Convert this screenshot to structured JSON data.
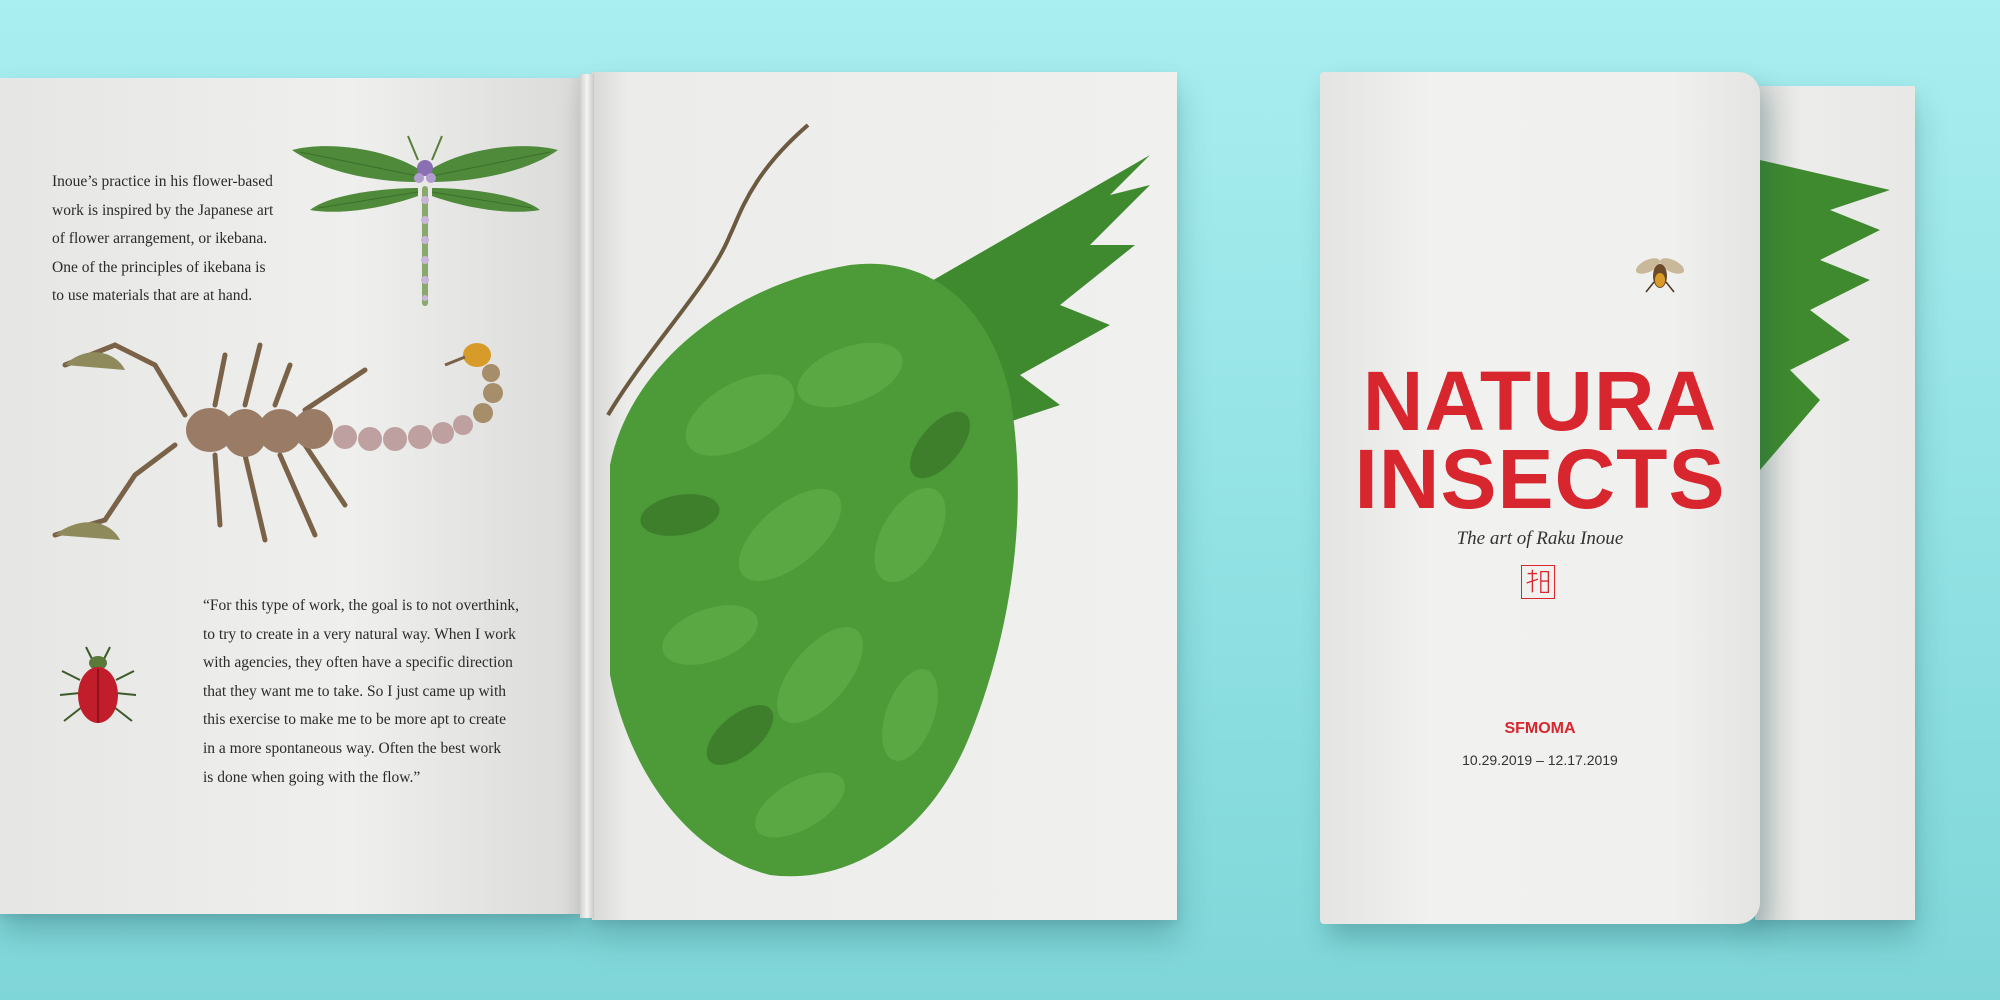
{
  "left_page": {
    "intro_lines": [
      "Inoue’s practice in his flower-based",
      "work is inspired by the Japanese art",
      "of flower arrangement, or ikebana.",
      "One of the principles of ikebana is",
      "to use materials that are at hand."
    ],
    "quote_lines": [
      "“For this type of work, the goal is to not overthink,",
      "to try to create in a very natural way. When I work",
      "with agencies, they often have a specific direction",
      "that they want me to take. So I just came up with",
      "this exercise to make me to be more apt to create",
      "in a more spontaneous way. Often the best work",
      "is done when going with the flow.”"
    ]
  },
  "cover": {
    "title_line1": "NATURA",
    "title_line2": "INSECTS",
    "subtitle": "The art of Raku Inoue",
    "logo": "SFMOMA",
    "dates": "10.29.2019 – 12.17.2019",
    "accent_color": "#d7262e"
  },
  "illustrations": [
    "dragonfly-illustration",
    "scorpion-illustration",
    "beetle-illustration",
    "leaf-wing-illustration",
    "bee-illustration",
    "seal-icon"
  ]
}
